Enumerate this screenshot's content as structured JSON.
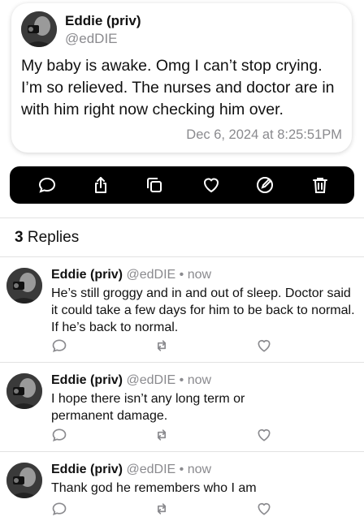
{
  "post": {
    "author_name": "Eddie (priv)",
    "author_handle": "@edDIE",
    "text": "My baby is awake. Omg I can’t stop crying. I’m so relieved. The nurses and doctor are in with him right now checking him over.",
    "timestamp": "Dec 6, 2024 at 8:25:51PM"
  },
  "actions": [
    "reply-icon",
    "share-icon",
    "copy-icon",
    "like-icon",
    "edit-icon",
    "delete-icon"
  ],
  "replies_header": {
    "count": "3",
    "label": "Replies"
  },
  "replies": [
    {
      "author_name": "Eddie (priv)",
      "author_handle": "@edDIE",
      "separator": "•",
      "time": "now",
      "text": "He’s still groggy and in and out of sleep. Doctor said it could take a few days for him to be back to normal. If he’s back to normal."
    },
    {
      "author_name": "Eddie (priv)",
      "author_handle": "@edDIE",
      "separator": "•",
      "time": "now",
      "text": "I hope there isn’t any long term or permanent damage."
    },
    {
      "author_name": "Eddie (priv)",
      "author_handle": "@edDIE",
      "separator": "•",
      "time": "now",
      "text": "Thank god he remembers who I am"
    }
  ],
  "colors": {
    "accent_bar": "#000000",
    "secondary_text": "#8a8a8e",
    "divider": "#e2e2e2"
  }
}
